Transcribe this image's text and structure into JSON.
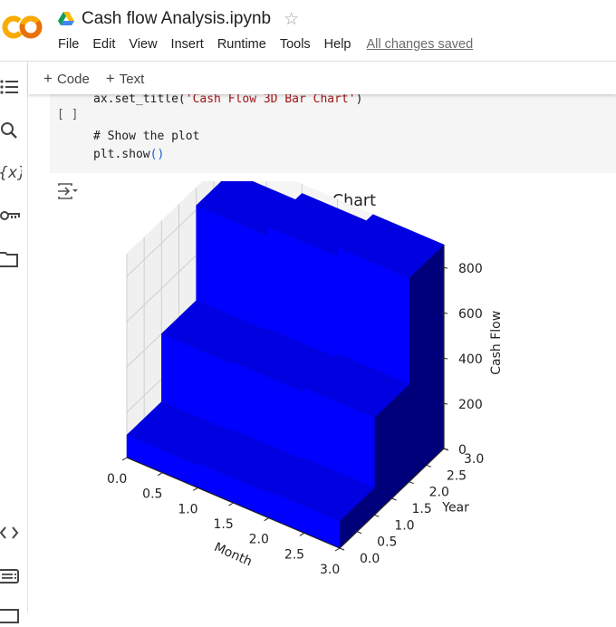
{
  "app": {
    "notebook_title": "Cash flow Analysis.ipynb",
    "logo_text": "CO",
    "menu": [
      "File",
      "Edit",
      "View",
      "Insert",
      "Runtime",
      "Tools",
      "Help"
    ],
    "save_status": "All changes saved",
    "icons": {
      "logo": "colab-logo",
      "drive": "google-drive-icon",
      "star": "star-icon",
      "sidebar": [
        "table-of-contents-icon",
        "search-icon",
        "variables-icon",
        "key-icon",
        "folder-icon",
        "code-snippets-icon",
        "command-palette-icon",
        "terminal-icon"
      ],
      "output": "output-toggle-icon"
    }
  },
  "toolbar": {
    "add_code_label": "Code",
    "add_text_label": "Text",
    "plus": "+"
  },
  "cell": {
    "exec_indicator": "[ ]",
    "line1_prefix": "ax.set_title(",
    "line1_string": "'Cash Flow 3D Bar Chart'",
    "line1_suffix": ")",
    "line2_comment": "# Show the plot",
    "line3_prefix": "plt.show",
    "line3_parens": "()"
  },
  "colors": {
    "bar_face": "#0000ff",
    "bar_top": "#0000e0",
    "bar_side": "#00007a",
    "pane": "#f2f2f2",
    "grid": "#cfcfcf",
    "logo_orange": "#f9ab00",
    "logo_dark_orange": "#e8710a"
  },
  "chart_data": {
    "type": "bar3d",
    "title": "Cash Flow 3D Bar Chart",
    "xlabel": "Month",
    "ylabel": "Year",
    "zlabel": "Cash Flow",
    "xlim": [
      0,
      3
    ],
    "ylim": [
      0,
      3
    ],
    "zlim": [
      0,
      900
    ],
    "x_ticks": [
      "0.0",
      "0.5",
      "1.0",
      "1.5",
      "2.0",
      "2.5",
      "3.0"
    ],
    "y_ticks": [
      "0.0",
      "0.5",
      "1.0",
      "1.5",
      "2.0",
      "2.5",
      "3.0"
    ],
    "z_ticks": [
      "0",
      "200",
      "400",
      "600",
      "800"
    ],
    "grid": true,
    "bar_width": 1,
    "bar_depth": 1,
    "bars": [
      {
        "month": 0,
        "year": 0,
        "value": 100
      },
      {
        "month": 1,
        "year": 0,
        "value": 110
      },
      {
        "month": 2,
        "year": 0,
        "value": 120
      },
      {
        "month": 0,
        "year": 1,
        "value": 400
      },
      {
        "month": 1,
        "year": 1,
        "value": 410
      },
      {
        "month": 2,
        "year": 1,
        "value": 430
      },
      {
        "month": 0,
        "year": 2,
        "value": 820
      },
      {
        "month": 1,
        "year": 2,
        "value": 860
      },
      {
        "month": 2,
        "year": 2,
        "value": 900
      }
    ]
  }
}
